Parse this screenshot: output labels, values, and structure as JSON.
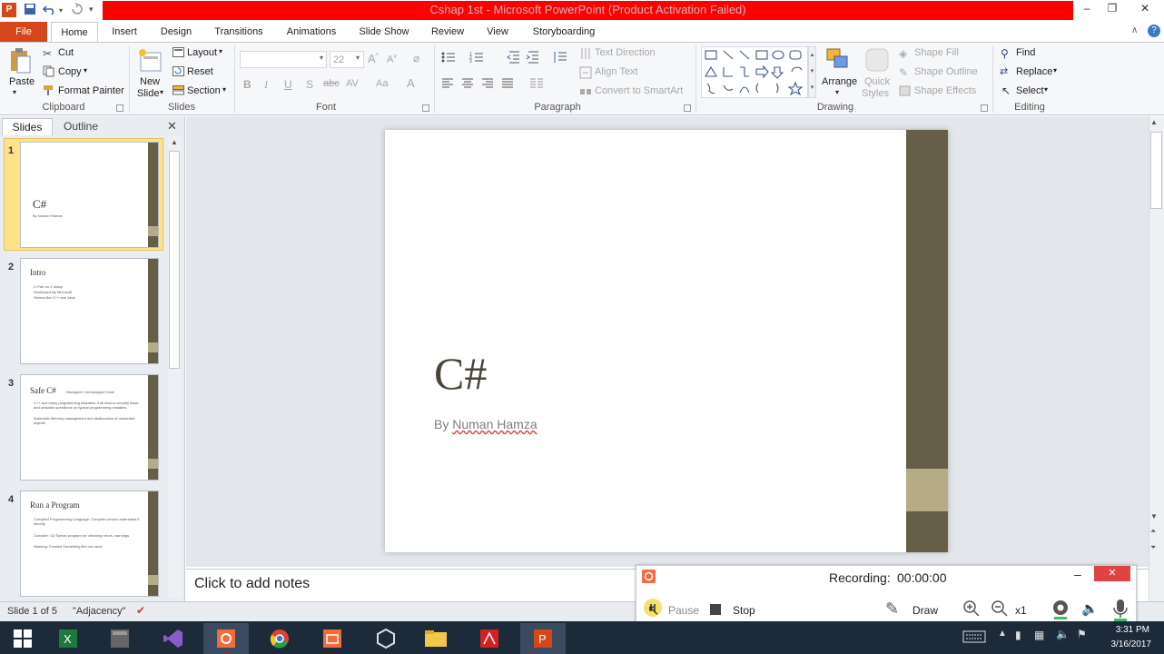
{
  "window": {
    "title": "Cshap 1st  -  Microsoft PowerPoint (Product Activation Failed)",
    "minimize": "–",
    "restore": "❐",
    "close": "✕"
  },
  "tabs": [
    "File",
    "Home",
    "Insert",
    "Design",
    "Transitions",
    "Animations",
    "Slide Show",
    "Review",
    "View",
    "Storyboarding"
  ],
  "ribbon": {
    "clipboard": {
      "paste": "Paste",
      "cut": "Cut",
      "copy": "Copy",
      "format_painter": "Format Painter",
      "label": "Clipboard"
    },
    "slides": {
      "new_slide_1": "New",
      "new_slide_2": "Slide",
      "layout": "Layout",
      "reset": "Reset",
      "section": "Section",
      "label": "Slides"
    },
    "font": {
      "font_name": "",
      "font_size": "22",
      "bold": "B",
      "italic": "I",
      "underline": "U",
      "shadow": "S",
      "strike": "abc",
      "spacing": "AV",
      "change_case": "Aa",
      "color": "A",
      "label": "Font"
    },
    "paragraph": {
      "text_direction": "Text Direction",
      "align_text": "Align Text",
      "convert_smartart": "Convert to SmartArt",
      "label": "Paragraph"
    },
    "drawing": {
      "arrange": "Arrange",
      "quick_styles_1": "Quick",
      "quick_styles_2": "Styles",
      "shape_fill": "Shape Fill",
      "shape_outline": "Shape Outline",
      "shape_effects": "Shape Effects",
      "label": "Drawing"
    },
    "editing": {
      "find": "Find",
      "replace": "Replace",
      "select": "Select",
      "label": "Editing"
    }
  },
  "panel": {
    "tab_slides": "Slides",
    "tab_outline": "Outline",
    "thumbnails": [
      {
        "num": "1",
        "title": "C#",
        "sub": "By Numan Hamza"
      },
      {
        "num": "2",
        "title": "Intro",
        "bullets": [
          "C Part on C sharp",
          "Developed By Microsoft",
          "Seems like C++ and Java"
        ]
      },
      {
        "num": "3",
        "title": "Safe C#",
        "tag": ": Managed / Unmanaged Code",
        "bullets": [
          "C++ and many programming mistakes: if all lead to security flaws and unstable operations on typical programming mistakes.",
          "Automatic Memory management and deallocation of unneeded objects."
        ]
      },
      {
        "num": "4",
        "title": "Run a Program",
        "bullets": [
          "Compiled Programming Language: Compiler cannot understand it directly",
          "Compiler: C# Syntax program for checking errors, warnings",
          "Warning: Created Something But not used"
        ]
      }
    ]
  },
  "slide": {
    "title": "C#",
    "subtitle_by": "By ",
    "subtitle_name": "Numan Hamza"
  },
  "notes": {
    "placeholder": "Click to add notes"
  },
  "status": {
    "slide_info": "Slide 1 of 5",
    "theme": "\"Adjacency\""
  },
  "recorder": {
    "label": "Recording:",
    "time": "00:00:00",
    "pause": "Pause",
    "stop": "Stop",
    "draw": "Draw",
    "zoom": "x1"
  },
  "taskbar": {
    "time": "3:31 PM",
    "date": "3/16/2017"
  },
  "colors": {
    "accent_bar": "#665e47",
    "accent_light": "#b5ab85",
    "file_tab": "#d6461b",
    "title_red": "#ff0000"
  }
}
